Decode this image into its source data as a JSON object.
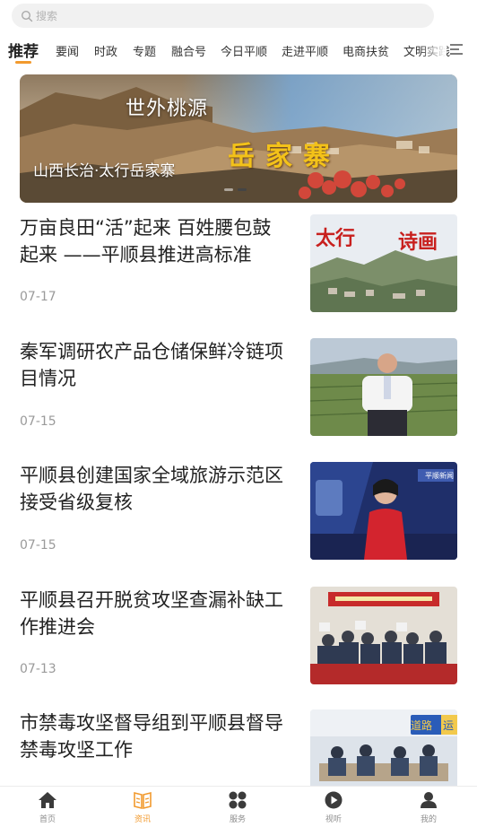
{
  "search": {
    "placeholder": "搜索",
    "icon": "search-icon"
  },
  "tabs": [
    {
      "label": "推荐",
      "active": true
    },
    {
      "label": "要闻"
    },
    {
      "label": "时政"
    },
    {
      "label": "专题"
    },
    {
      "label": "融合号"
    },
    {
      "label": "今日平顺"
    },
    {
      "label": "走进平顺"
    },
    {
      "label": "电商扶贫"
    },
    {
      "label": "文明实践"
    }
  ],
  "banner": {
    "caption": "山西长治·太行岳家寨",
    "art_text_1": "世外桃源",
    "art_text_2": "岳家寨",
    "slide_count": 2,
    "active_slide": 2
  },
  "news": [
    {
      "title": "万亩良田“活”起来 百姓腰包鼓起来 ——平顺县推进高标准",
      "date": "07-17",
      "thumb_text_1": "太行",
      "thumb_text_2": "诗画"
    },
    {
      "title": "秦军调研农产品仓储保鲜冷链项目情况",
      "date": "07-15"
    },
    {
      "title": "平顺县创建国家全域旅游示范区接受省级复核",
      "date": "07-15",
      "thumb_text_1": "平顺新闻"
    },
    {
      "title": "平顺县召开脱贫攻坚查漏补缺工作推进会",
      "date": "07-13"
    },
    {
      "title": "市禁毒攻坚督导组到平顺县督导禁毒攻坚工作",
      "date": "",
      "thumb_text_1": "道路",
      "thumb_text_2": "运"
    }
  ],
  "bottom_nav": [
    {
      "label": "首页",
      "icon": "home-icon"
    },
    {
      "label": "资讯",
      "icon": "news-book-icon",
      "active": true
    },
    {
      "label": "服务",
      "icon": "services-icon"
    },
    {
      "label": "视听",
      "icon": "play-icon"
    },
    {
      "label": "我的",
      "icon": "profile-icon"
    }
  ],
  "colors": {
    "accent": "#f29a2e",
    "text": "#222222",
    "muted": "#9a9a9a",
    "search_bg": "#f1f1f1"
  }
}
